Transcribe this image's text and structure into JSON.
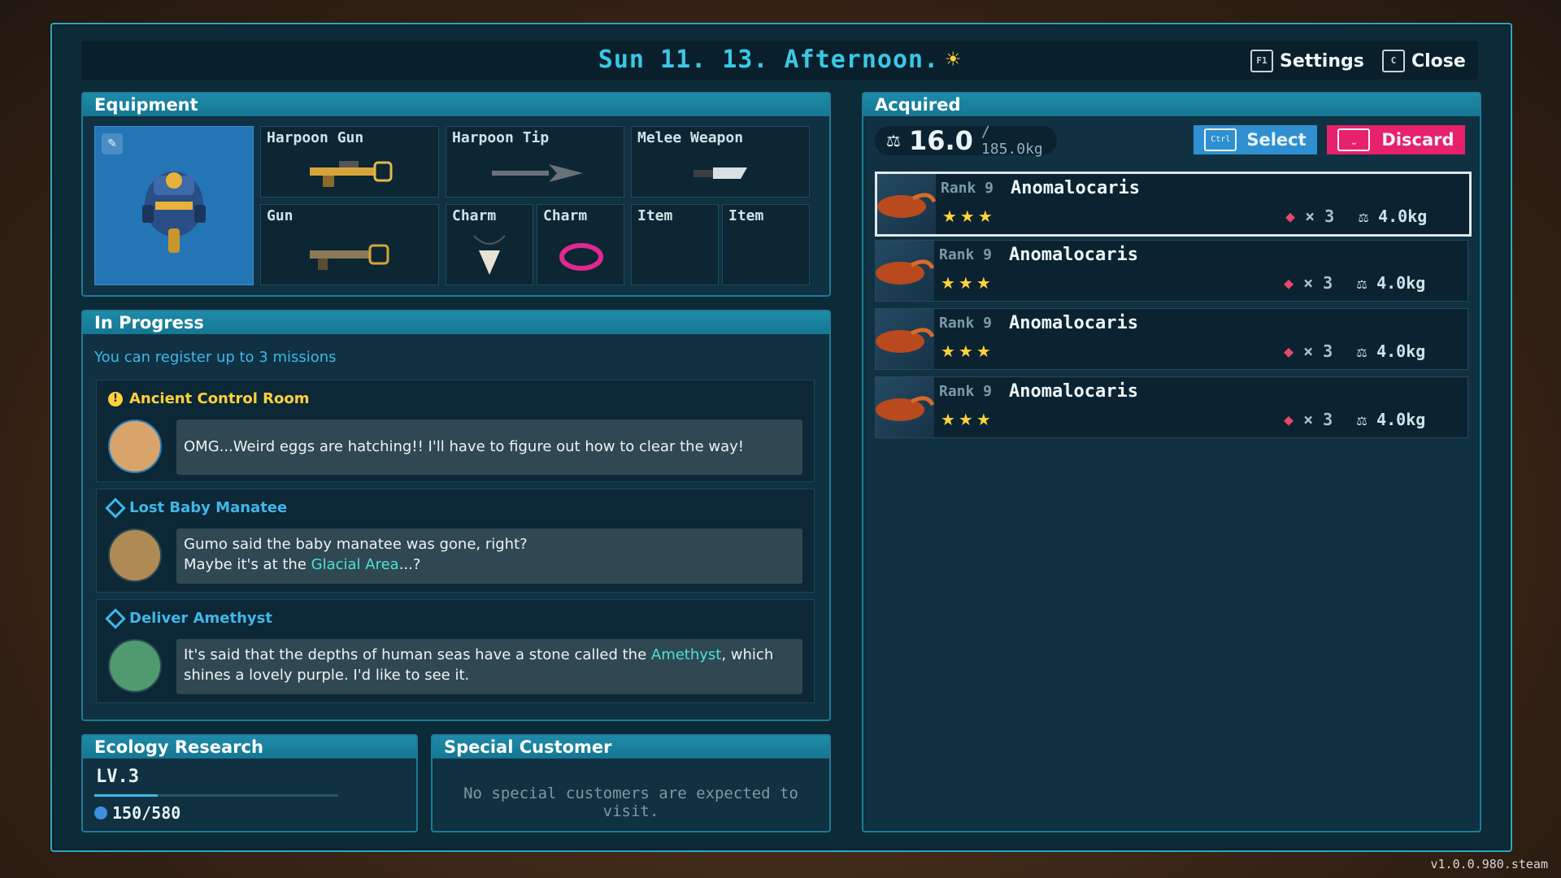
{
  "header": {
    "date_label": "Sun 11. 13.  Afternoon.",
    "weather_icon": "sun-icon",
    "settings": {
      "key": "F1",
      "label": "Settings"
    },
    "close": {
      "key": "C",
      "label": "Close"
    }
  },
  "equipment": {
    "title": "Equipment",
    "slots": [
      {
        "label": "Harpoon Gun"
      },
      {
        "label": "Harpoon Tip"
      },
      {
        "label": "Melee Weapon"
      },
      {
        "label": "Gun"
      },
      {
        "label": "Charm"
      },
      {
        "label": "Charm"
      },
      {
        "label": "Item"
      },
      {
        "label": "Item"
      }
    ]
  },
  "in_progress": {
    "title": "In Progress",
    "subtitle": "You can register up to 3 missions",
    "missions": [
      {
        "title": "Ancient Control Room",
        "icon": "exclamation-icon",
        "text": "OMG...Weird eggs are hatching!! I'll have to figure out how to clear the way!"
      },
      {
        "title": "Lost Baby Manatee",
        "icon": "diamond-icon",
        "line1": "Gumo said the baby manatee was gone, right?",
        "line2_pre": "Maybe it's at the ",
        "line2_hl": "Glacial Area",
        "line2_post": "...?"
      },
      {
        "title": "Deliver Amethyst",
        "icon": "diamond-icon",
        "pre": "It's said that the depths of human seas have a stone called the ",
        "hl": "Amethyst",
        "post": ", which shines a lovely purple. I'd like to see it."
      }
    ]
  },
  "ecology": {
    "title": "Ecology Research",
    "level": "LV.3",
    "progress_text": "150/580",
    "progress": 0.259
  },
  "special_customer": {
    "title": "Special Customer",
    "message": "No special customers are expected to visit."
  },
  "acquired": {
    "title": "Acquired",
    "weight": "16.0",
    "capacity": "/ 185.0kg",
    "select": {
      "key": "Ctrl",
      "label": "Select"
    },
    "discard": {
      "label": "Discard"
    },
    "items": [
      {
        "rank": "Rank 9",
        "name": "Anomalocaris",
        "stars": "★★★",
        "qty": "× 3",
        "weight": "4.0kg"
      },
      {
        "rank": "Rank 9",
        "name": "Anomalocaris",
        "stars": "★★★",
        "qty": "× 3",
        "weight": "4.0kg"
      },
      {
        "rank": "Rank 9",
        "name": "Anomalocaris",
        "stars": "★★★",
        "qty": "× 3",
        "weight": "4.0kg"
      },
      {
        "rank": "Rank 9",
        "name": "Anomalocaris",
        "stars": "★★★",
        "qty": "× 3",
        "weight": "4.0kg"
      }
    ]
  },
  "version": "v1.0.0.980.steam",
  "colors": {
    "accent": "#39c8e6",
    "discard": "#e8216b",
    "select": "#2f8fd0",
    "star": "#ffd23a",
    "highlight": "#4fe0d4"
  }
}
